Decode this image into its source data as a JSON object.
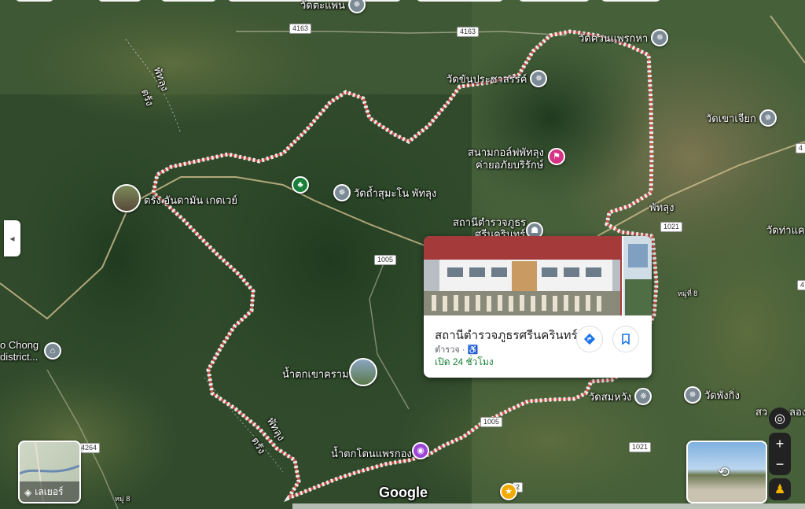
{
  "map": {
    "type": "satellite",
    "brand": "Google",
    "boundary_color": "#e57373"
  },
  "labels": {
    "wat_tapaen": "วัดตะแพน",
    "wat_khuan_phraek_ha": "วัดควนแพรกหา",
    "wat_khanprachasan": "วัดขันประชาสรรค์",
    "wat_khao_chiak": "วัดเขาเจียก",
    "golf": "สนามกอล์ฟพัทลุง",
    "golf2": "ค่ายอภัยบริรักษ์",
    "wat_tham": "วัดถ้ำสุมะโน พัทลุง",
    "trang_tunnel": "ตรัง อันดามัน เกตเวย์",
    "police_map": "สถานีตำรวจภูธร",
    "police_map2": "ศรีนครินทร์",
    "phatthalung_right": "พัทลุง",
    "wat_tha_khae": "วัดท่าแค",
    "phatthalung_tl": "พัทลุง",
    "trang_tl": "ตรัง",
    "phatthalung_bl": "พัทลุง",
    "trang_bl": "ตรัง",
    "waterfall": "น้ำตกเขาคราม",
    "waterfall2": "น้ำตกโตนแพรกอง",
    "wat_som_wang": "วัดสมหวัง",
    "wat_phung_ping": "วัดพังกิ่ง",
    "chong_district": "o Chong\ndistrict...",
    "moo8_right": "หมู่ที่ 8",
    "moo8_bottom": "หมู่ 8",
    "edge_right": "สว",
    "edge_right2": "ลอง"
  },
  "routes": [
    "4163",
    "4163",
    "1005",
    "1021",
    "1005",
    "4264",
    "1021",
    "4",
    "4",
    "2"
  ],
  "card": {
    "title": "สถานีตำรวจภูธรศรีนครินทร์",
    "category": "ตำรวจ ·",
    "hours": "เปิด 24 ชั่วโมง"
  },
  "controls": {
    "layers_label": "เลเยอร์",
    "zoom_in": "+",
    "zoom_out": "−",
    "collapse": "◂"
  }
}
